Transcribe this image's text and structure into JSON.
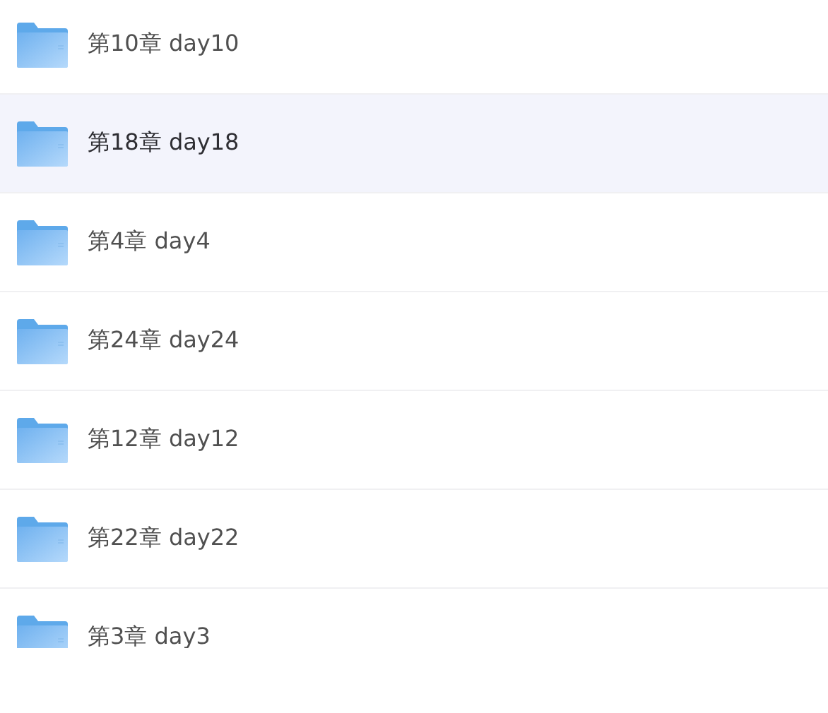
{
  "folders": [
    {
      "name": "第10章 day10",
      "selected": false
    },
    {
      "name": "第18章 day18",
      "selected": true
    },
    {
      "name": "第4章 day4",
      "selected": false
    },
    {
      "name": "第24章 day24",
      "selected": false
    },
    {
      "name": "第12章 day12",
      "selected": false
    },
    {
      "name": "第22章 day22",
      "selected": false
    },
    {
      "name": "第3章 day3",
      "selected": false
    }
  ]
}
